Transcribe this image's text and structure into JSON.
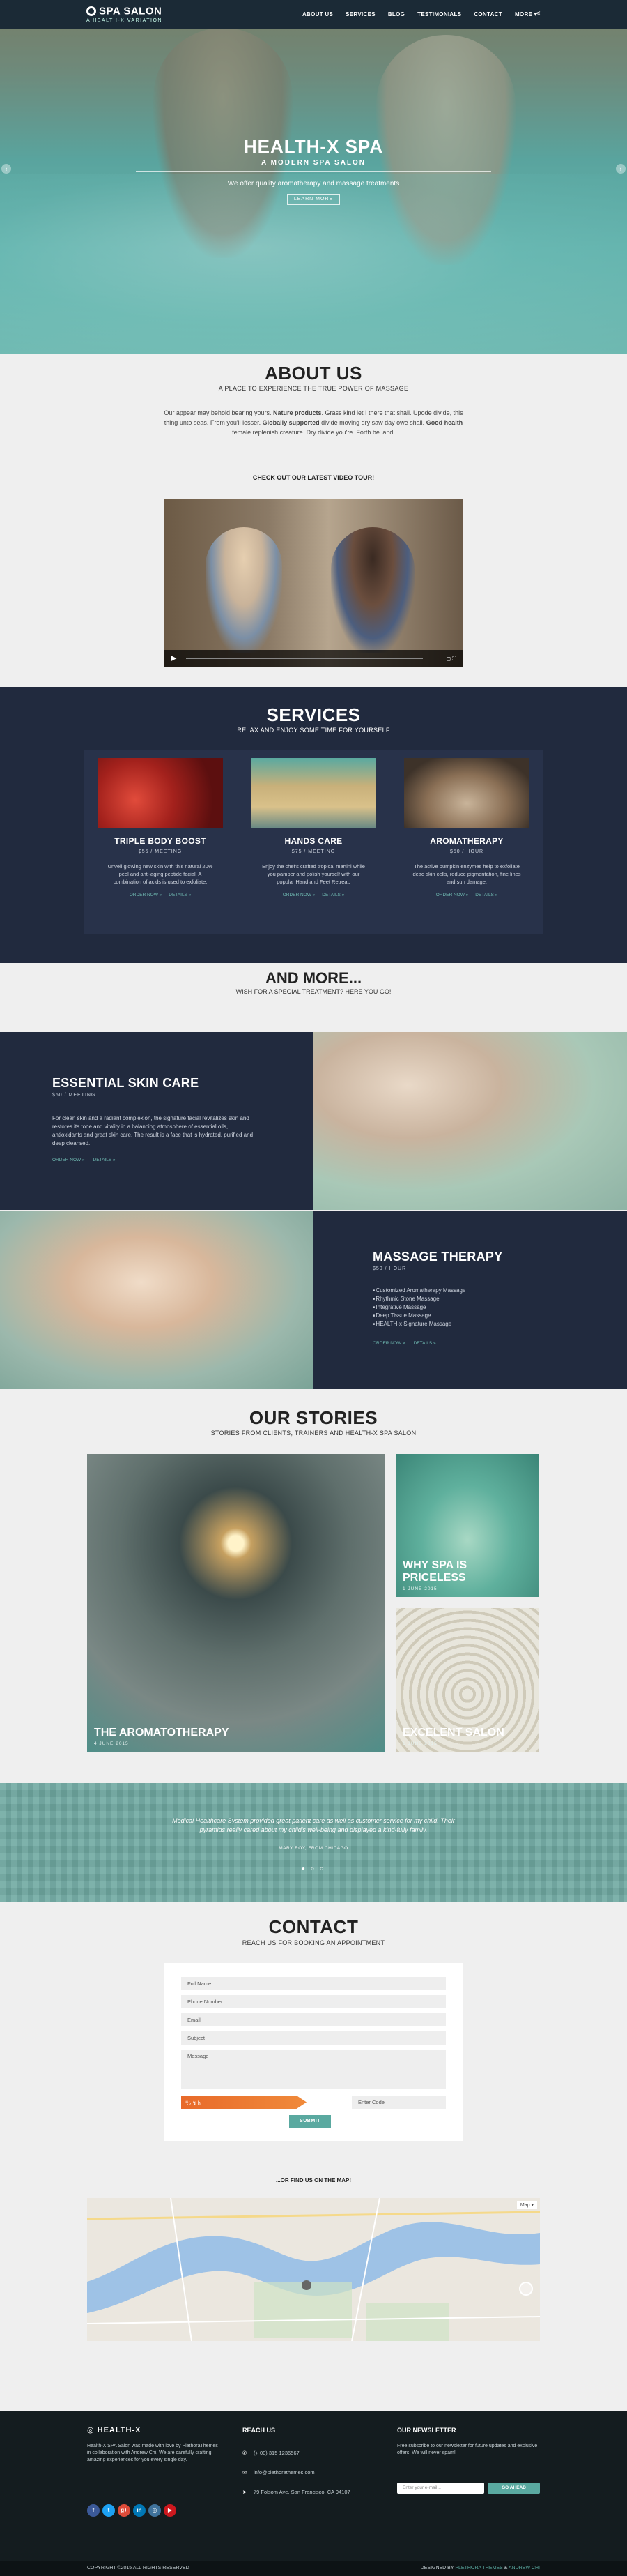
{
  "nav": {
    "logo_name": "SPA SALON",
    "logo_tag": "A HEALTH-X VARIATION",
    "items": [
      "ABOUT US",
      "SERVICES",
      "BLOG",
      "TESTIMONIALS",
      "CONTACT",
      "MORE ▾"
    ]
  },
  "hero": {
    "title": "HEALTH-X SPA",
    "subtitle": "A MODERN SPA SALON",
    "text": "We offer quality aromatherapy and massage treatments",
    "button": "LEARN MORE"
  },
  "about": {
    "title": "ABOUT US",
    "subtitle": "A PLACE TO EXPERIENCE THE TRUE POWER OF MASSAGE",
    "text_1": "Our appear may behold bearing yours. ",
    "text_1b": "Nature products",
    "text_2": ". Grass kind let I there that shall. Upode divide, this thing unto seas. From you'll lesser. ",
    "text_2b": "Globally supported",
    "text_3": " divide moving dry saw day owe shall. ",
    "text_3b": "Good health",
    "text_4": " female replenish creature. Dry divide you're. Forth be land.",
    "video_label": "CHECK OUT OUR LATEST VIDEO TOUR!"
  },
  "services": {
    "title": "SERVICES",
    "subtitle": "RELAX AND ENJOY SOME TIME FOR YOURSELF",
    "items": [
      {
        "title": "TRIPLE BODY BOOST",
        "price": "$55 / MEETING",
        "desc": "Unveil glowing new skin with this natural 20% peel and anti-aging peptide facial. A combination of acids is used to exfoliate.",
        "order": "ORDER NOW »",
        "details": "DETAILS »"
      },
      {
        "title": "HANDS CARE",
        "price": "$75 / MEETING",
        "desc": "Enjoy the chef's crafted tropical martini while you pamper and polish yourself with our popular Hand and Feet Retreat.",
        "order": "ORDER NOW »",
        "details": "DETAILS »"
      },
      {
        "title": "AROMATHERAPY",
        "price": "$50 / HOUR",
        "desc": "The active pumpkin enzymes help to exfoliate dead skin cells, reduce pigmentation, fine lines and sun damage.",
        "order": "ORDER NOW »",
        "details": "DETAILS »"
      }
    ]
  },
  "more": {
    "title": "AND MORE...",
    "subtitle": "WISH FOR A SPECIAL TREATMENT? HERE YOU GO!",
    "skin": {
      "title": "ESSENTIAL SKIN CARE",
      "price": "$60 / MEETING",
      "text": "For clean skin and a radiant complexion, the signature facial revitalizes skin and restores its tone and vitality in a balancing atmosphere of essential oils, antioxidants and great skin care. The result is a face that is hydrated, purified and deep cleansed.",
      "order": "ORDER NOW »",
      "details": "DETAILS »"
    },
    "massage": {
      "title": "MASSAGE THERAPY",
      "price": "$50 / HOUR",
      "list": [
        "Customized Aromatherapy Massage",
        "Rhythmic Stone Massage",
        "Integrative Massage",
        "Deep Tissue Massage",
        "HEALTH-x Signature Massage"
      ],
      "order": "ORDER NOW »",
      "details": "DETAILS »"
    }
  },
  "stories": {
    "title": "OUR STORIES",
    "subtitle": "STORIES FROM CLIENTS, TRAINERS AND HEALTH-X SPA SALON",
    "items": [
      {
        "title": "THE AROMATOTHERAPY",
        "date": "4 JUNE 2015"
      },
      {
        "title": "WHY SPA IS PRICELESS",
        "date": "1 JUNE 2015"
      },
      {
        "title": "EXCELENT SALON",
        "date": "1 JUNE 2015"
      }
    ]
  },
  "testimonial": {
    "quote": "Medical Healthcare System provided great patient care as well as customer service for my child. Their pyramids really cared about my child's well-being and displayed a kind-fully family.",
    "who": "MARY ROY, FROM CHICAGO",
    "dots": "● ○ ○"
  },
  "contact": {
    "title": "CONTACT",
    "subtitle": "REACH US FOR BOOKING AN APPOINTMENT",
    "fields": [
      "Full Name",
      "Phone Number",
      "Email",
      "Subject",
      "Message"
    ],
    "captcha": "₹ϟ ↯ hi",
    "captcha_placeholder": "Enter Code",
    "submit": "SUBMIT",
    "map_label": "...OR FIND US ON THE MAP!"
  },
  "footer": {
    "brand": "HEALTH-X",
    "about": "Health-X SPA Salon was made with love by PlathoraThemes in collaboration with Andrew Chi. We are carefully crafting amazing experiences for you every single day.",
    "reach_title": "REACH US",
    "phone": "(+ 00) 315 1236567",
    "email": "info@plethorathemes.com",
    "address": "79 Folsom Ave, San Francisco, CA 94107",
    "newsletter_title": "OUR NEWSLETTER",
    "newsletter_text": "Free subscribe to our newsletter for future updates and exclusive offers. We will never spam!",
    "newsletter_placeholder": "Enter your e-mail...",
    "newsletter_button": "GO AHEAD",
    "copyright": "COPYRIGHT ©2015 ALL RIGHTS RESERVED",
    "designed_by": "DESIGNED BY",
    "designer_1": "PLETHORA THEMES",
    "designer_and": " & ",
    "designer_2": "ANDREW CHI",
    "social": [
      "f",
      "t",
      "g+",
      "in",
      "◎",
      "▶"
    ]
  },
  "colors": {
    "accent": "#5aa9a0",
    "dark": "#212a3e",
    "footer": "#141c1f"
  }
}
